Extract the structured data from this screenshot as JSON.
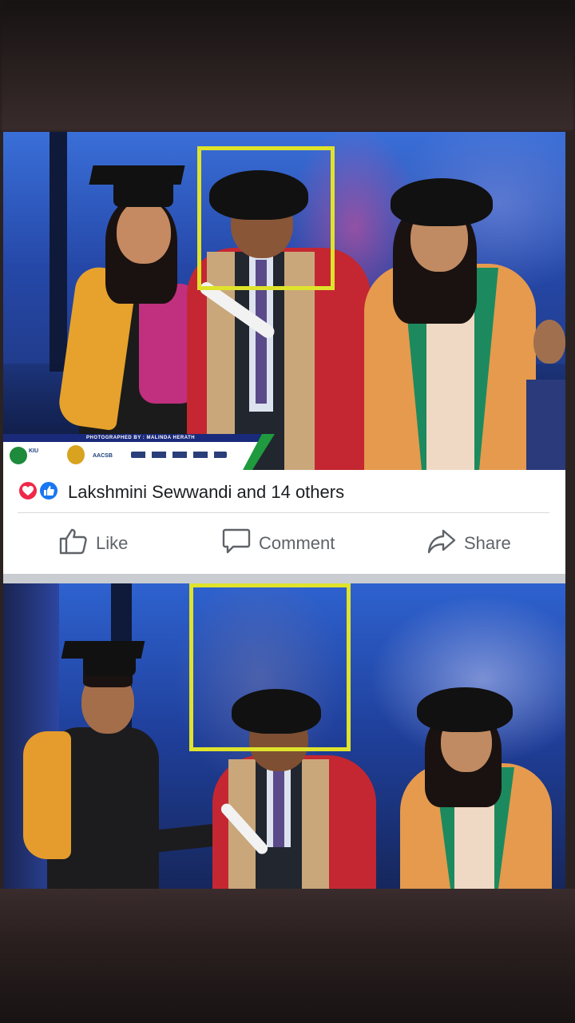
{
  "post": {
    "banner_credit": "PHOTOGRAPHED BY : MALINDA HERATH",
    "logos": {
      "kiu": "KIU",
      "aacsb": "AACSB"
    },
    "reactions": {
      "love_icon": "heart-icon",
      "like_icon": "thumbs-up-icon",
      "summary": "Lakshmini Sewwandi and 14 others"
    },
    "actions": {
      "like_label": "Like",
      "comment_label": "Comment",
      "share_label": "Share"
    }
  },
  "colors": {
    "highlight": "#dfe32b",
    "love": "#f02849",
    "like": "#1877f2",
    "action_text": "#5f6368"
  }
}
